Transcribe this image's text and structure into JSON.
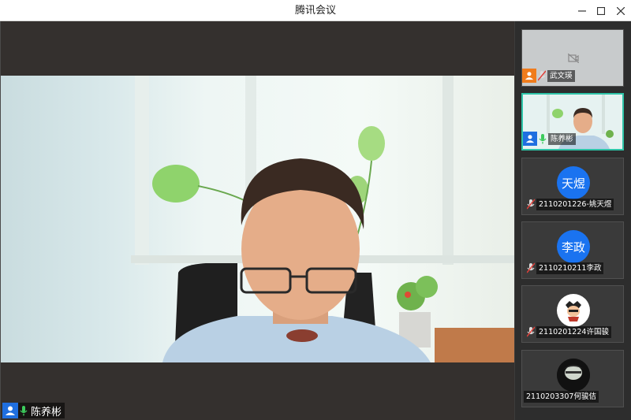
{
  "window": {
    "title": "腾讯会议"
  },
  "main_video": {
    "speaker_name": "陈养彬",
    "mic_state": "on"
  },
  "participants": [
    {
      "name": "武文瑛",
      "mic_state": "muted",
      "video": "off",
      "badge_color": "#f07c1c"
    },
    {
      "name": "陈养彬",
      "mic_state": "on",
      "video": "on",
      "badge_color": "#1f6fe0"
    },
    {
      "name": "2110201226-姚天煜",
      "mic_state": "muted",
      "avatar_text": "天煜",
      "avatar_color": "#1a73f0"
    },
    {
      "name": "2110210211李政",
      "mic_state": "muted",
      "avatar_text": "李政",
      "avatar_color": "#1a73f0"
    },
    {
      "name": "2110201224许国骏",
      "mic_state": "muted",
      "avatar_type": "cartoon"
    },
    {
      "name": "2110203307何骏佶",
      "mic_state": "none",
      "avatar_type": "photo"
    }
  ],
  "colors": {
    "active_border": "#2ec4a8",
    "mic_on": "#3ccb5c",
    "mic_muted": "#e0403a"
  }
}
